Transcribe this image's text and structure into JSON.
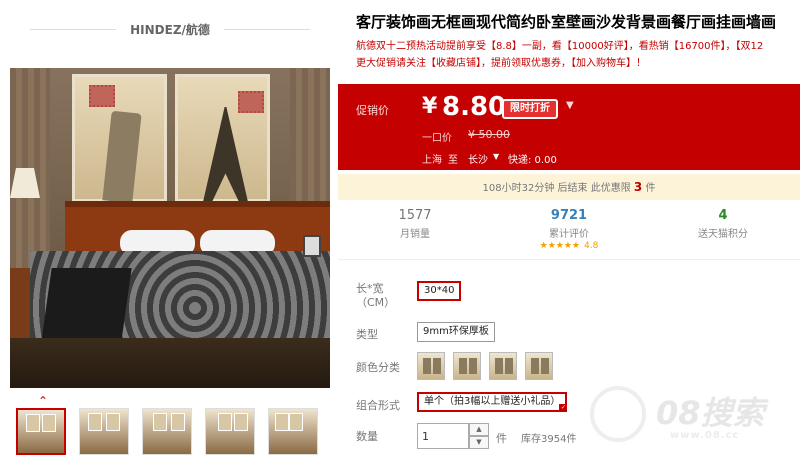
{
  "brand": {
    "name": "HINDEZ/航德"
  },
  "product": {
    "title": "客厅装饰画无框画现代简约卧室壁画沙发背景画餐厅画挂画墙画",
    "subtitle_line1": "航德双十二预热活动提前享受【8.8】一副，看【10000好评】，看热销【16700件】，【双12",
    "subtitle_line2": "更大促销请关注【收藏店铺】，提前领取优惠券，【加入购物车】！"
  },
  "price": {
    "label": "促销价",
    "currency": "¥",
    "value": "8.80",
    "badge": "限时打折",
    "caret": "▼",
    "original_label": "一口价",
    "original_value": "¥ 50.00"
  },
  "shipping": {
    "from": "上海",
    "to_word": "至",
    "destination": "长沙",
    "caret": "▼",
    "fee": "快递: 0.00"
  },
  "countdown": {
    "time_text": "108小时32分钟 后结束",
    "limit_text": "此优惠限",
    "limit_num": "3",
    "limit_unit": "件"
  },
  "stats": {
    "sales_value": "1577",
    "sales_label": "月销量",
    "reviews_value": "9721",
    "reviews_label": "累计评价",
    "stars": "★★★★★",
    "score": "4.8",
    "points_value": "4",
    "points_label": "送天猫积分"
  },
  "options": {
    "size_label": "长*宽（CM）",
    "size_value": "30*40",
    "type_label": "类型",
    "type_value": "9mm环保厚板",
    "color_label": "颜色分类",
    "combo_label": "组合形式",
    "combo_value": "单个（拍3幅以上赠送小礼品）",
    "tick": "✓"
  },
  "quantity": {
    "label": "数量",
    "value": "1",
    "up": "▲",
    "down": "▼",
    "unit": "件",
    "stock": "库存3954件"
  },
  "nav": {
    "up_arrow": "⌃"
  },
  "watermark": {
    "text": "08搜索",
    "url": "www.08.cc"
  },
  "colors": {
    "accent": "#c40000",
    "countdown_bg": "#fdf3d9",
    "reviews": "#3b7fb8",
    "points": "#2a8a2a"
  }
}
